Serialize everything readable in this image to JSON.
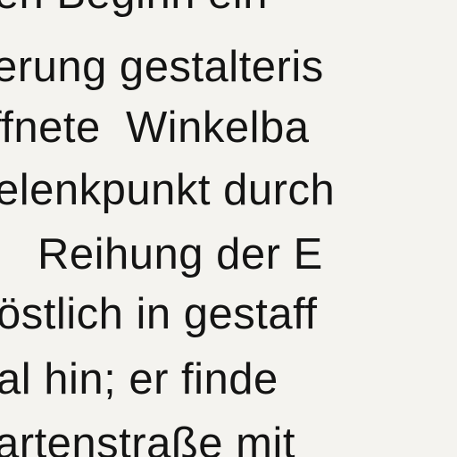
{
  "lines": [
    "den Beginn ein",
    "erung gestalteris",
    "ffnete  Winkelba",
    "elenkpunkt durch",
    "Reihung der E",
    "östlich in gestaff",
    "al hin; er finde",
    "artenstraße mit"
  ]
}
